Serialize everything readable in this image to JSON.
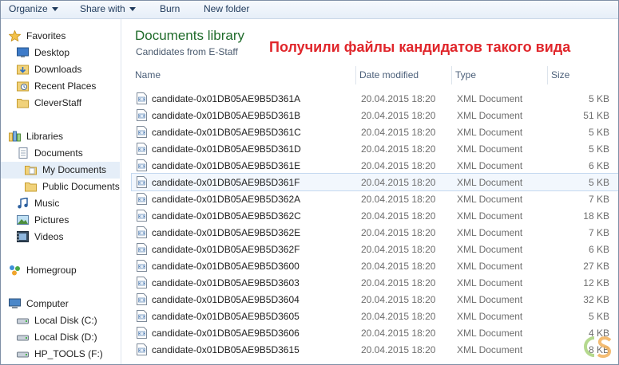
{
  "toolbar": {
    "organize": "Organize",
    "share_with": "Share with",
    "burn": "Burn",
    "new_folder": "New folder"
  },
  "nav": {
    "favorites": "Favorites",
    "desktop": "Desktop",
    "downloads": "Downloads",
    "recent_places": "Recent Places",
    "cleverstaff": "CleverStaff",
    "libraries": "Libraries",
    "documents": "Documents",
    "my_documents": "My Documents",
    "public_documents": "Public Documents",
    "music": "Music",
    "pictures": "Pictures",
    "videos": "Videos",
    "homegroup": "Homegroup",
    "computer": "Computer",
    "drive_c": "Local Disk (C:)",
    "drive_d": "Local Disk (D:)",
    "drive_f": "HP_TOOLS (F:)"
  },
  "library": {
    "title": "Documents library",
    "subtitle": "Candidates from E-Staff"
  },
  "annotation": "Получили файлы кандидатов такого вида",
  "columns": {
    "name": "Name",
    "date": "Date modified",
    "type": "Type",
    "size": "Size"
  },
  "files": [
    {
      "name": "candidate-0x01DB05AE9B5D361A",
      "date": "20.04.2015 18:20",
      "type": "XML Document",
      "size": "5 KB"
    },
    {
      "name": "candidate-0x01DB05AE9B5D361B",
      "date": "20.04.2015 18:20",
      "type": "XML Document",
      "size": "51 KB"
    },
    {
      "name": "candidate-0x01DB05AE9B5D361C",
      "date": "20.04.2015 18:20",
      "type": "XML Document",
      "size": "5 KB"
    },
    {
      "name": "candidate-0x01DB05AE9B5D361D",
      "date": "20.04.2015 18:20",
      "type": "XML Document",
      "size": "5 KB"
    },
    {
      "name": "candidate-0x01DB05AE9B5D361E",
      "date": "20.04.2015 18:20",
      "type": "XML Document",
      "size": "6 KB"
    },
    {
      "name": "candidate-0x01DB05AE9B5D361F",
      "date": "20.04.2015 18:20",
      "type": "XML Document",
      "size": "5 KB"
    },
    {
      "name": "candidate-0x01DB05AE9B5D362A",
      "date": "20.04.2015 18:20",
      "type": "XML Document",
      "size": "7 KB"
    },
    {
      "name": "candidate-0x01DB05AE9B5D362C",
      "date": "20.04.2015 18:20",
      "type": "XML Document",
      "size": "18 KB"
    },
    {
      "name": "candidate-0x01DB05AE9B5D362E",
      "date": "20.04.2015 18:20",
      "type": "XML Document",
      "size": "7 KB"
    },
    {
      "name": "candidate-0x01DB05AE9B5D362F",
      "date": "20.04.2015 18:20",
      "type": "XML Document",
      "size": "6 KB"
    },
    {
      "name": "candidate-0x01DB05AE9B5D3600",
      "date": "20.04.2015 18:20",
      "type": "XML Document",
      "size": "27 KB"
    },
    {
      "name": "candidate-0x01DB05AE9B5D3603",
      "date": "20.04.2015 18:20",
      "type": "XML Document",
      "size": "12 KB"
    },
    {
      "name": "candidate-0x01DB05AE9B5D3604",
      "date": "20.04.2015 18:20",
      "type": "XML Document",
      "size": "32 KB"
    },
    {
      "name": "candidate-0x01DB05AE9B5D3605",
      "date": "20.04.2015 18:20",
      "type": "XML Document",
      "size": "5 KB"
    },
    {
      "name": "candidate-0x01DB05AE9B5D3606",
      "date": "20.04.2015 18:20",
      "type": "XML Document",
      "size": "4 KB"
    },
    {
      "name": "candidate-0x01DB05AE9B5D3615",
      "date": "20.04.2015 18:20",
      "type": "XML Document",
      "size": "8 KB"
    }
  ],
  "colors": {
    "library_title": "#1f6b2a",
    "annotation": "#e0262b",
    "selection": "#e5eef8"
  }
}
